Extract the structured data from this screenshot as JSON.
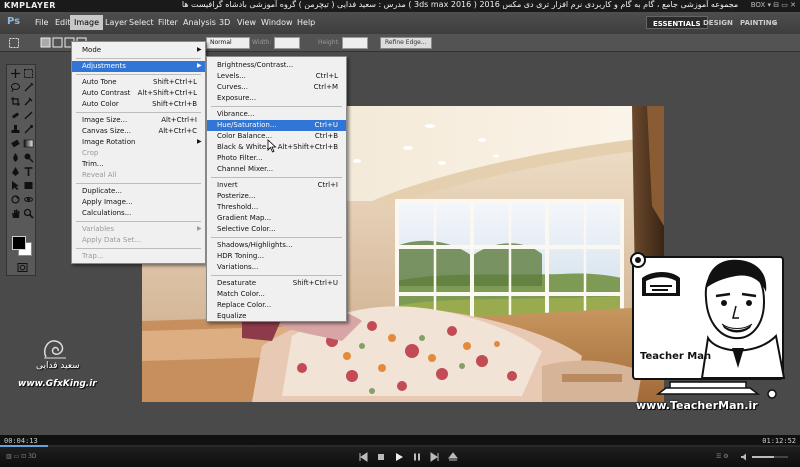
{
  "player": {
    "logo": "KMPLAYER",
    "title": "مجموعه آموزشی جامع ، گام به گام و کاربردی نرم افزار تری دی مکس 2016 ( 3ds max 2016 ) مدرس : سعید فدایی ( تیچرمن ) گروه آموزشی بادشاه گرافیست ها",
    "controls_label": "BOX ▾  ⊟  ▭  ✕",
    "time_current": "00:04:13",
    "time_total": "01:12:52",
    "progress": 0.06,
    "volume": 0.6,
    "small_left": "▥ ▭ ⊡ 3D",
    "small_right": "☰  ⚙"
  },
  "photoshop": {
    "logo": "Ps",
    "menus": [
      "File",
      "Edit",
      "Image",
      "Layer",
      "Select",
      "Filter",
      "Analysis",
      "3D",
      "View",
      "Window",
      "Help"
    ],
    "active_menu": "Image",
    "workspaces": [
      "ESSENTIALS",
      "DESIGN",
      "PAINTING",
      "»"
    ],
    "active_workspace": "ESSENTIALS",
    "window_buttons": [
      "–",
      "▭",
      "✕"
    ],
    "options": {
      "style_value": "Normal",
      "width_label": "Width:",
      "height_label": "Height:",
      "refine_edge": "Refine Edge..."
    },
    "image_menu": [
      {
        "label": "Mode",
        "shortcut": "",
        "submenu": true
      },
      {
        "sep": true
      },
      {
        "label": "Adjustments",
        "shortcut": "",
        "submenu": true,
        "highlight": true
      },
      {
        "sep": true
      },
      {
        "label": "Auto Tone",
        "shortcut": "Shift+Ctrl+L"
      },
      {
        "label": "Auto Contrast",
        "shortcut": "Alt+Shift+Ctrl+L"
      },
      {
        "label": "Auto Color",
        "shortcut": "Shift+Ctrl+B"
      },
      {
        "sep": true
      },
      {
        "label": "Image Size...",
        "shortcut": "Alt+Ctrl+I"
      },
      {
        "label": "Canvas Size...",
        "shortcut": "Alt+Ctrl+C"
      },
      {
        "label": "Image Rotation",
        "shortcut": "",
        "submenu": true
      },
      {
        "label": "Crop",
        "shortcut": "",
        "disabled": true
      },
      {
        "label": "Trim...",
        "shortcut": ""
      },
      {
        "label": "Reveal All",
        "shortcut": "",
        "disabled": true
      },
      {
        "sep": true
      },
      {
        "label": "Duplicate...",
        "shortcut": ""
      },
      {
        "label": "Apply Image...",
        "shortcut": ""
      },
      {
        "label": "Calculations...",
        "shortcut": ""
      },
      {
        "sep": true
      },
      {
        "label": "Variables",
        "shortcut": "",
        "submenu": true,
        "disabled": true
      },
      {
        "label": "Apply Data Set...",
        "shortcut": "",
        "disabled": true
      },
      {
        "sep": true
      },
      {
        "label": "Trap...",
        "shortcut": "",
        "disabled": true
      }
    ],
    "adjust_menu": [
      {
        "label": "Brightness/Contrast...",
        "shortcut": ""
      },
      {
        "label": "Levels...",
        "shortcut": "Ctrl+L"
      },
      {
        "label": "Curves...",
        "shortcut": "Ctrl+M"
      },
      {
        "label": "Exposure...",
        "shortcut": ""
      },
      {
        "sep": true
      },
      {
        "label": "Vibrance...",
        "shortcut": ""
      },
      {
        "label": "Hue/Saturation...",
        "shortcut": "Ctrl+U",
        "highlight": true
      },
      {
        "label": "Color Balance...",
        "shortcut": "Ctrl+B"
      },
      {
        "label": "Black & White...",
        "shortcut": "Alt+Shift+Ctrl+B"
      },
      {
        "label": "Photo Filter...",
        "shortcut": ""
      },
      {
        "label": "Channel Mixer...",
        "shortcut": ""
      },
      {
        "sep": true
      },
      {
        "label": "Invert",
        "shortcut": "Ctrl+I"
      },
      {
        "label": "Posterize...",
        "shortcut": ""
      },
      {
        "label": "Threshold...",
        "shortcut": ""
      },
      {
        "label": "Gradient Map...",
        "shortcut": ""
      },
      {
        "label": "Selective Color...",
        "shortcut": ""
      },
      {
        "sep": true
      },
      {
        "label": "Shadows/Highlights...",
        "shortcut": ""
      },
      {
        "label": "HDR Toning...",
        "shortcut": ""
      },
      {
        "label": "Variations...",
        "shortcut": ""
      },
      {
        "sep": true
      },
      {
        "label": "Desaturate",
        "shortcut": "Shift+Ctrl+U"
      },
      {
        "label": "Match Color...",
        "shortcut": ""
      },
      {
        "label": "Replace Color...",
        "shortcut": ""
      },
      {
        "label": "Equalize",
        "shortcut": ""
      }
    ]
  },
  "overlay": {
    "teacher_brand": "Teacher Man",
    "teacher_url": "www.TeacherMan.ir",
    "signature_name": "سعید فدایی",
    "signature_site": "www.GfxKing.ir"
  },
  "colors": {
    "menu_highlight": "#3176d6",
    "ps_background": "#4a4a4a",
    "progress": "#6aa0d8"
  }
}
